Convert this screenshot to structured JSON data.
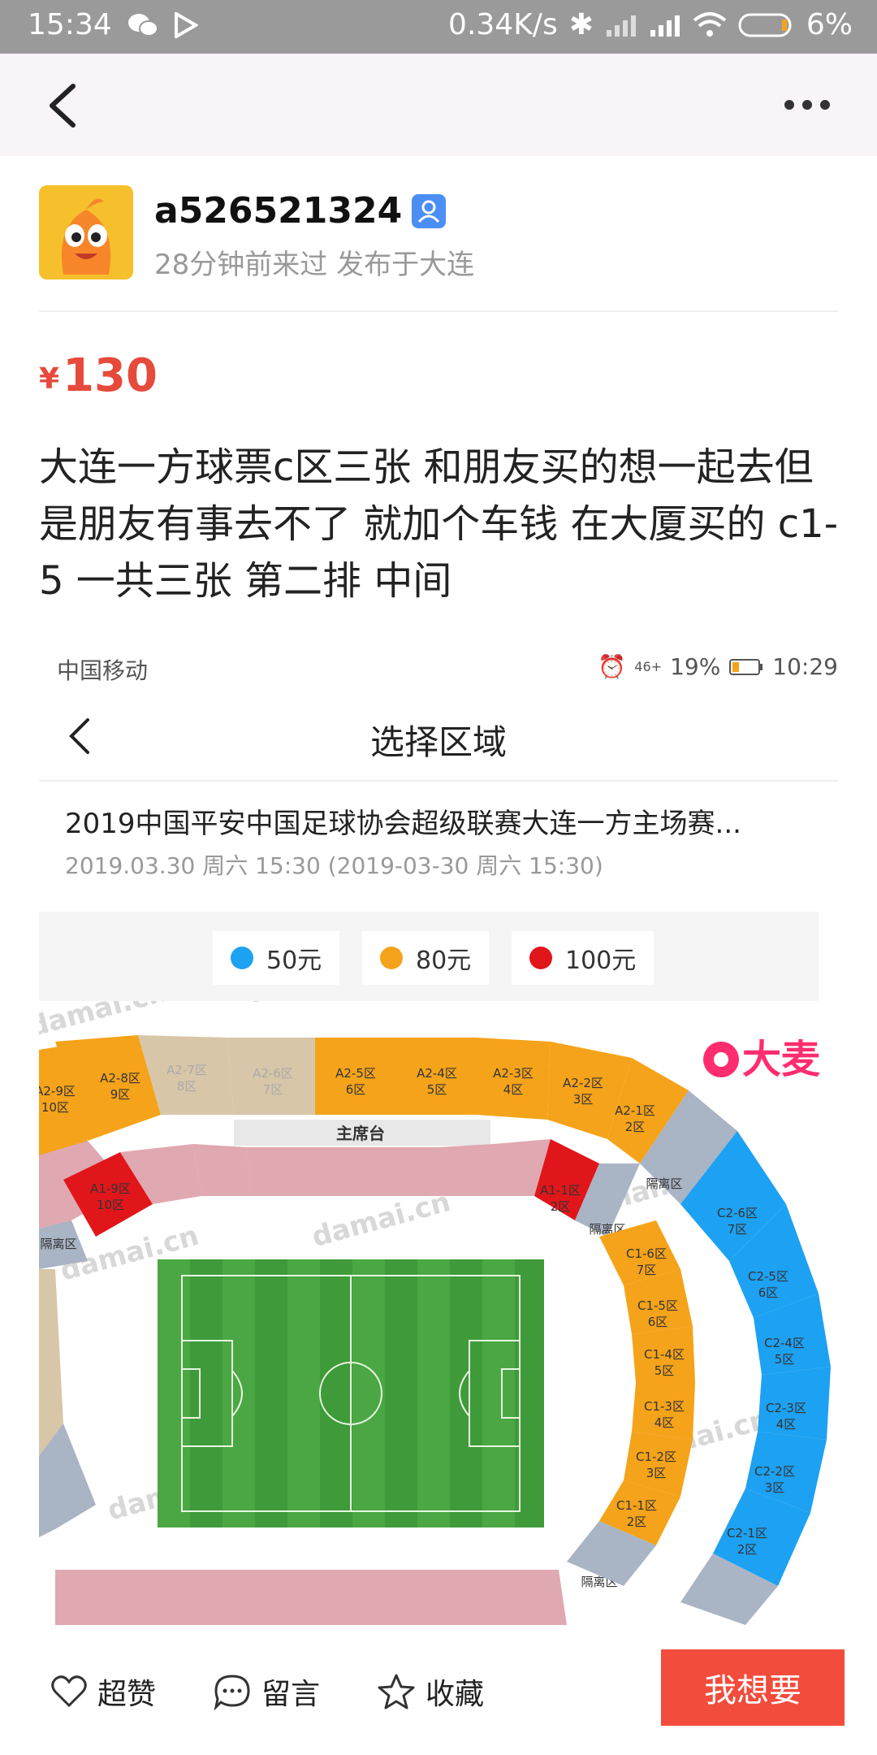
{
  "status_bar": {
    "time": "15:34",
    "speed": "0.34K/s",
    "battery": "6%"
  },
  "nav": {
    "back_icon": "chevron-left-icon",
    "more_icon": "more-dots-icon"
  },
  "seller": {
    "username": "a526521324",
    "meta": "28分钟前来过 发布于大连"
  },
  "listing": {
    "currency": "¥",
    "price": "130",
    "description": "大连一方球票c区三张 和朋友买的想一起去但是朋友有事去不了 就加个车钱 在大厦买的 c1-5 一共三张  第二排 中间"
  },
  "screenshot": {
    "operator": "中国移动",
    "signal": "46+",
    "battery": "19%",
    "time": "10:29",
    "header_title": "选择区域",
    "event_title": "2019中国平安中国足球协会超级联赛大连一方主场赛...",
    "event_date": "2019.03.30 周六  15:30 (2019-03-30 周六 15:30)",
    "legend": [
      {
        "label": "50元",
        "color": "#1da1f2"
      },
      {
        "label": "80元",
        "color": "#f5a31a"
      },
      {
        "label": "100元",
        "color": "#e0161b"
      }
    ],
    "map_logo": "大麦",
    "watermark": "damai.cn",
    "sections_top": [
      {
        "name": "A2-9区",
        "num": "10区",
        "price": "80元"
      },
      {
        "name": "A2-8区",
        "num": "9区",
        "price": "80元"
      },
      {
        "name": "A2-7区",
        "num": "8区",
        "price": "sold"
      },
      {
        "name": "A2-6区",
        "num": "7区",
        "price": "sold"
      },
      {
        "name": "A2-5区",
        "num": "6区",
        "price": "80元"
      },
      {
        "name": "A2-4区",
        "num": "5区",
        "price": "80元"
      },
      {
        "name": "A2-3区",
        "num": "4区",
        "price": "80元"
      },
      {
        "name": "A2-2区",
        "num": "3区",
        "price": "80元"
      },
      {
        "name": "A2-1区",
        "num": "2区",
        "price": "80元"
      }
    ],
    "main_stand": "主席台",
    "sections_a1": [
      {
        "name": "A1-9区",
        "num": "10区"
      },
      {
        "name": "A1-1区",
        "num": "2区"
      }
    ],
    "isolation_label": "隔离区",
    "sections_c1": [
      {
        "name": "C1-6区",
        "num": "7区"
      },
      {
        "name": "C1-5区",
        "num": "6区"
      },
      {
        "name": "C1-4区",
        "num": "5区"
      },
      {
        "name": "C1-3区",
        "num": "4区"
      },
      {
        "name": "C1-2区",
        "num": "3区"
      },
      {
        "name": "C1-1区",
        "num": "2区"
      }
    ],
    "sections_c2": [
      {
        "name": "C2-6区",
        "num": "7区"
      },
      {
        "name": "C2-5区",
        "num": "6区"
      },
      {
        "name": "C2-4区",
        "num": "5区"
      },
      {
        "name": "C2-3区",
        "num": "4区"
      },
      {
        "name": "C2-2区",
        "num": "3区"
      },
      {
        "name": "C2-1区",
        "num": "2区"
      }
    ]
  },
  "bottom_bar": {
    "like": "超赞",
    "comment": "留言",
    "favorite": "收藏",
    "cta": "我想要"
  }
}
